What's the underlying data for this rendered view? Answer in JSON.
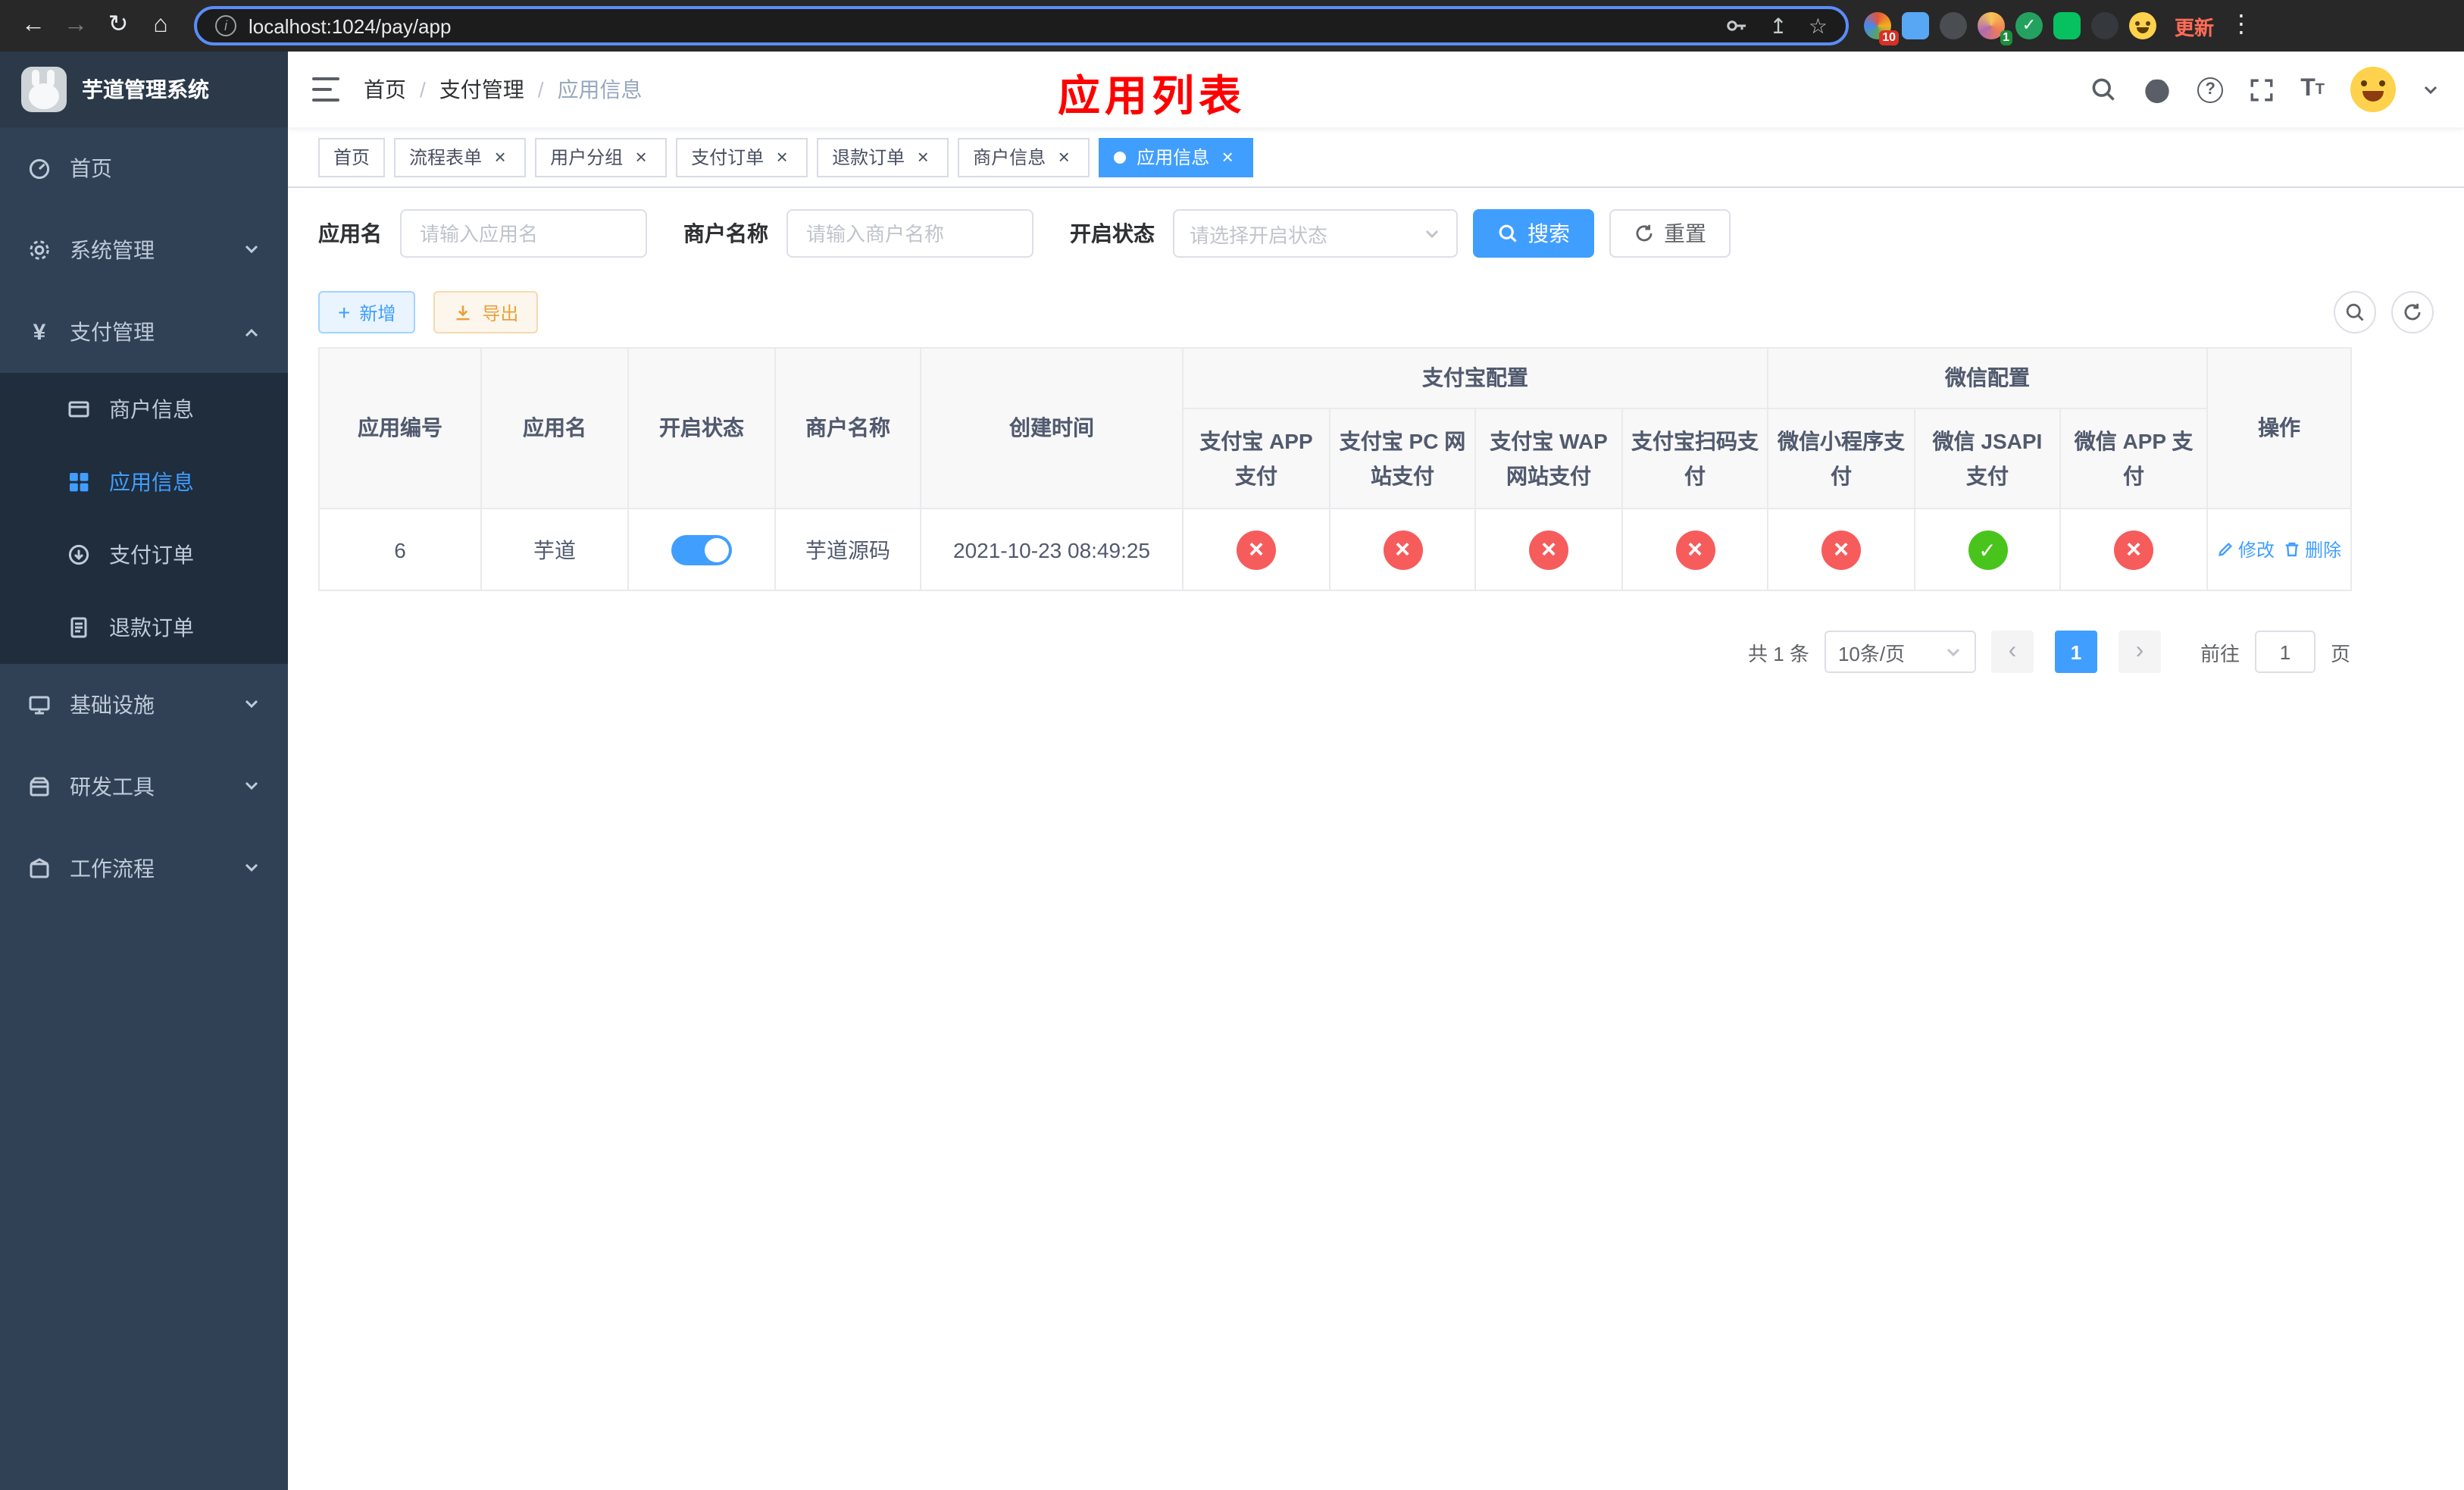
{
  "browser": {
    "url": "localhost:1024/pay/app",
    "update_label": "更新",
    "extension_badge": "10",
    "avatar_badge": "1"
  },
  "icons": {
    "back": "←",
    "forward": "→",
    "refresh": "↻",
    "home": "⌂",
    "share": "↥",
    "star": "☆",
    "menu_dots": "⋮",
    "close": "×",
    "check": "✓",
    "plus": "+",
    "yen": "¥",
    "prev": "‹",
    "next": "›",
    "font_large": "T",
    "font_small": "T"
  },
  "sidebar": {
    "title": "芋道管理系统",
    "items": [
      {
        "label": "首页"
      },
      {
        "label": "系统管理"
      },
      {
        "label": "支付管理"
      },
      {
        "label": "基础设施"
      },
      {
        "label": "研发工具"
      },
      {
        "label": "工作流程"
      }
    ],
    "submenu_items": [
      {
        "label": "商户信息"
      },
      {
        "label": "应用信息",
        "active": true
      },
      {
        "label": "支付订单"
      },
      {
        "label": "退款订单"
      }
    ]
  },
  "header": {
    "breadcrumb": [
      "首页",
      "支付管理",
      "应用信息"
    ],
    "annotation": "应用列表"
  },
  "tabs": [
    {
      "label": "首页",
      "closable": false
    },
    {
      "label": "流程表单",
      "closable": true
    },
    {
      "label": "用户分组",
      "closable": true
    },
    {
      "label": "支付订单",
      "closable": true
    },
    {
      "label": "退款订单",
      "closable": true
    },
    {
      "label": "商户信息",
      "closable": true
    },
    {
      "label": "应用信息",
      "closable": true,
      "active": true
    }
  ],
  "filters": {
    "app_name_label": "应用名",
    "app_name_placeholder": "请输入应用名",
    "merchant_label": "商户名称",
    "merchant_placeholder": "请输入商户名称",
    "status_label": "开启状态",
    "status_placeholder": "请选择开启状态",
    "search_label": "搜索",
    "reset_label": "重置"
  },
  "toolbar": {
    "add_label": "新增",
    "export_label": "导出"
  },
  "table": {
    "group_alipay": "支付宝配置",
    "group_wechat": "微信配置",
    "columns": [
      "应用编号",
      "应用名",
      "开启状态",
      "商户名称",
      "创建时间",
      "支付宝 APP 支付",
      "支付宝 PC 网站支付",
      "支付宝 WAP 网站支付",
      "支付宝扫码支付",
      "微信小程序支付",
      "微信 JSAPI 支付",
      "微信 APP 支付",
      "操作"
    ],
    "rows": [
      {
        "id": "6",
        "name": "芋道",
        "enabled": true,
        "merchant": "芋道源码",
        "created_at": "2021-10-23 08:49:25",
        "statuses": [
          "fail",
          "fail",
          "fail",
          "fail",
          "fail",
          "success",
          "fail"
        ],
        "edit_label": "修改",
        "delete_label": "删除"
      }
    ]
  },
  "pagination": {
    "total_text": "共 1 条",
    "page_size": "10条/页",
    "current_page": "1",
    "goto_label": "前往",
    "goto_value": "1",
    "unit_label": "页"
  },
  "colors": {
    "primary": "#409eff",
    "danger": "#f65c5c",
    "success": "#49c41c",
    "annotation": "#ff0000",
    "sidebar_bg": "#304156",
    "submenu_bg": "#1f2d3d"
  }
}
